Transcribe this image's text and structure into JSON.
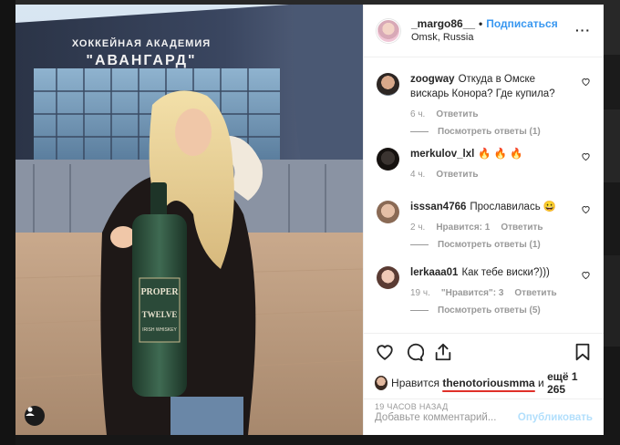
{
  "post": {
    "username": "_margo86__",
    "separator": "•",
    "follow_label": "Подписаться",
    "location": "Omsk, Russia",
    "more_icon": "more-horizontal-icon"
  },
  "photo": {
    "building_sign_line1": "ХОККЕЙНАЯ АКАДЕМИЯ",
    "building_sign_line2": "\"АВАНГАРД\"",
    "bottle_label_line1": "PROPER",
    "bottle_label_line2": "TWELVE",
    "bottle_label_line3": "IRISH WHISKEY"
  },
  "comments": [
    {
      "user": "zoogway",
      "text": "Откуда в Омске вискарь Конора? Где купила?",
      "time": "6 ч.",
      "likes": "",
      "reply": "Ответить",
      "view_replies": "Посмотреть ответы (1)"
    },
    {
      "user": "merkulov_lxl",
      "text": "🔥 🔥 🔥",
      "time": "4 ч.",
      "likes": "",
      "reply": "Ответить",
      "view_replies": ""
    },
    {
      "user": "isssan4766",
      "text": "Прославилась 😀",
      "time": "2 ч.",
      "likes": "Нравится: 1",
      "reply": "Ответить",
      "view_replies": "Посмотреть ответы (1)"
    },
    {
      "user": "lerkaaa01",
      "text": "Как тебе виски?)))",
      "time": "19 ч.",
      "likes": "\"Нравится\": 3",
      "reply": "Ответить",
      "view_replies": "Посмотреть ответы (5)"
    }
  ],
  "likes": {
    "prefix": "Нравится",
    "liker": "thenotoriousmma",
    "middle": "и",
    "suffix": "ещё 1 265"
  },
  "time_ago": "19 ЧАСОВ НАЗАД",
  "add_comment": {
    "placeholder": "Добавьте комментарий...",
    "publish_label": "Опубликовать"
  },
  "colors": {
    "link_blue": "#3897f0",
    "publish_disabled": "#b2dffc",
    "underline_red": "#e0302a"
  }
}
